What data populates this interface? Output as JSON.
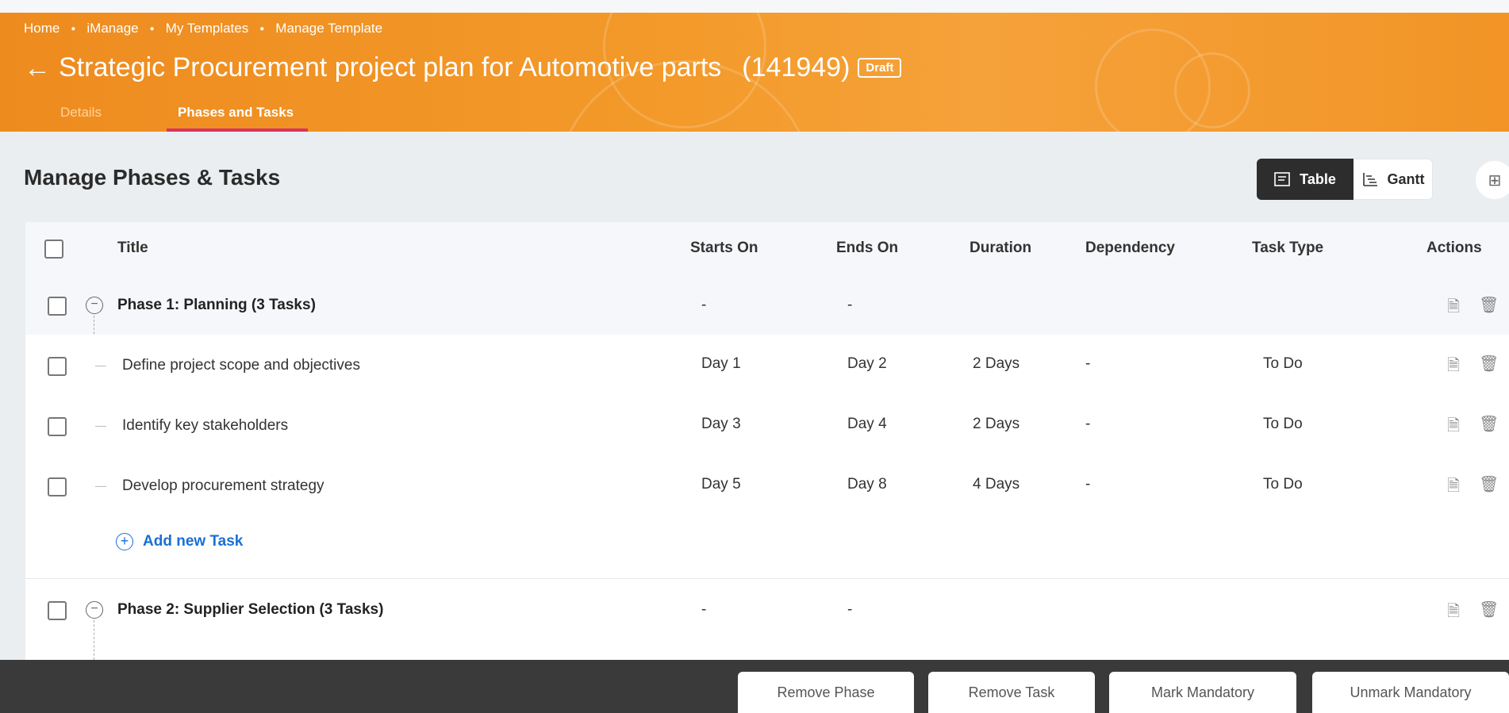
{
  "breadcrumb": [
    "Home",
    "iManage",
    "My Templates",
    "Manage Template"
  ],
  "header": {
    "back_icon": "arrow-left-icon",
    "title": "Strategic Procurement project plan for Automotive parts",
    "id": "(141949)",
    "status_badge": "Draft",
    "brand_color": "#f39a2a"
  },
  "tabs": [
    {
      "label": "Details",
      "active": false
    },
    {
      "label": "Phases and Tasks",
      "active": true
    }
  ],
  "section_title": "Manage Phases & Tasks",
  "view_toggle": {
    "table_label": "Table",
    "gantt_label": "Gantt",
    "selected": "Table"
  },
  "columns": [
    "Title",
    "Starts On",
    "Ends On",
    "Duration",
    "Dependency",
    "Task Type",
    "Actions"
  ],
  "phases": [
    {
      "title": "Phase 1: Planning (3 Tasks)",
      "starts_on": "-",
      "ends_on": "-",
      "tasks": [
        {
          "title": "Define project scope and objectives",
          "starts_on": "Day 1",
          "ends_on": "Day 2",
          "duration": "2 Days",
          "dependency": "-",
          "task_type": "To Do"
        },
        {
          "title": "Identify key stakeholders",
          "starts_on": "Day 3",
          "ends_on": "Day 4",
          "duration": "2 Days",
          "dependency": "-",
          "task_type": "To Do"
        },
        {
          "title": "Develop procurement strategy",
          "starts_on": "Day 5",
          "ends_on": "Day 8",
          "duration": "4 Days",
          "dependency": "-",
          "task_type": "To Do"
        }
      ],
      "add_task_label": "Add new Task"
    },
    {
      "title": "Phase 2: Supplier Selection (3 Tasks)",
      "starts_on": "-",
      "ends_on": "-"
    }
  ],
  "bottom_actions": [
    "Remove Phase",
    "Remove Task",
    "Mark Mandatory",
    "Unmark Mandatory"
  ]
}
